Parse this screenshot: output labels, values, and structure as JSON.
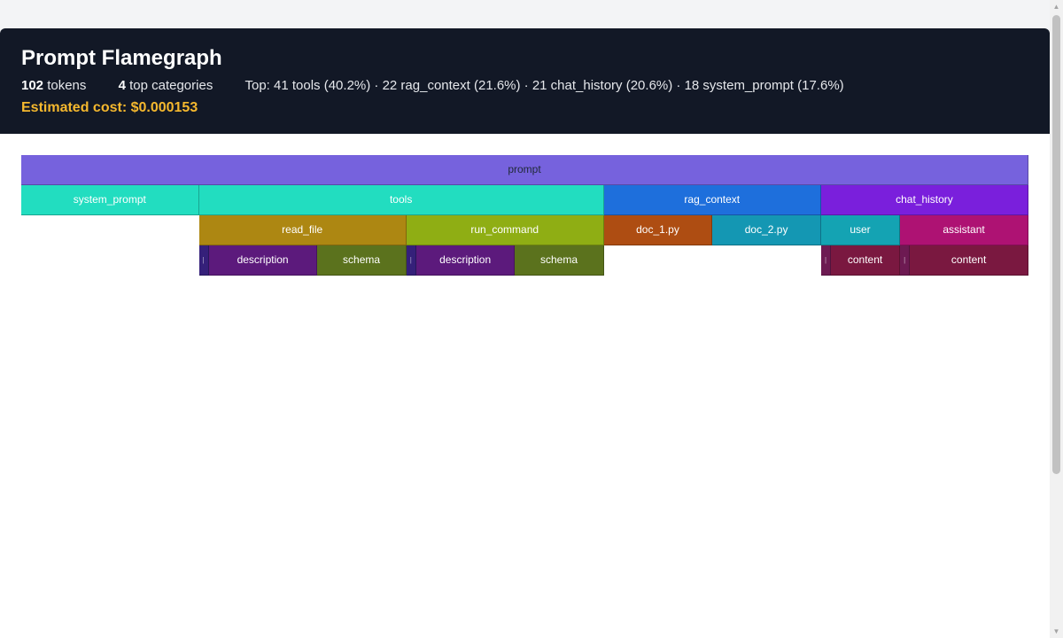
{
  "header": {
    "title": "Prompt Flamegraph",
    "tokens_value": "102",
    "tokens_label": "tokens",
    "categories_value": "4",
    "categories_label": "top categories",
    "top_summary": "Top: 41 tools (40.2%) · 22 rag_context (21.6%) · 21 chat_history (20.6%) · 18 system_prompt (17.6%)",
    "cost": "Estimated cost: $0.000153"
  },
  "flamegraph": {
    "total_tokens": 102,
    "root": {
      "label": "prompt",
      "tokens": 102,
      "color": "#7662dd",
      "children": [
        {
          "label": "system_prompt",
          "tokens": 18,
          "color": "#22ddc0",
          "children": []
        },
        {
          "label": "tools",
          "tokens": 41,
          "color": "#22ddc0",
          "children": [
            {
              "label": "read_file",
              "tokens": 21,
              "color": "#ad8712",
              "children": [
                {
                  "label": "",
                  "tokens": 1,
                  "color": "#35207a",
                  "children": []
                },
                {
                  "label": "description",
                  "tokens": 11,
                  "color": "#5c1a7c",
                  "children": []
                },
                {
                  "label": "schema",
                  "tokens": 9,
                  "color": "#5b721d",
                  "children": []
                }
              ]
            },
            {
              "label": "run_command",
              "tokens": 20,
              "color": "#8fae14",
              "children": [
                {
                  "label": "",
                  "tokens": 1,
                  "color": "#35207a",
                  "children": []
                },
                {
                  "label": "description",
                  "tokens": 10,
                  "color": "#5c1a7c",
                  "children": []
                },
                {
                  "label": "schema",
                  "tokens": 9,
                  "color": "#5b721d",
                  "children": []
                }
              ]
            }
          ]
        },
        {
          "label": "rag_context",
          "tokens": 22,
          "color": "#1e6fdc",
          "children": [
            {
              "label": "doc_1.py",
              "tokens": 11,
              "color": "#ae4d12",
              "children": []
            },
            {
              "label": "doc_2.py",
              "tokens": 11,
              "color": "#1497b3",
              "children": []
            }
          ]
        },
        {
          "label": "chat_history",
          "tokens": 21,
          "color": "#7a1fdc",
          "children": [
            {
              "label": "user",
              "tokens": 8,
              "color": "#14a3b3",
              "children": [
                {
                  "label": "",
                  "tokens": 1,
                  "color": "#6d1a52",
                  "children": []
                },
                {
                  "label": "content",
                  "tokens": 7,
                  "color": "#7a1840",
                  "children": []
                }
              ]
            },
            {
              "label": "assistant",
              "tokens": 13,
              "color": "#ae1273",
              "children": [
                {
                  "label": "",
                  "tokens": 1,
                  "color": "#6d1a52",
                  "children": []
                },
                {
                  "label": "content",
                  "tokens": 12,
                  "color": "#7a1840",
                  "children": []
                }
              ]
            }
          ]
        }
      ]
    }
  }
}
